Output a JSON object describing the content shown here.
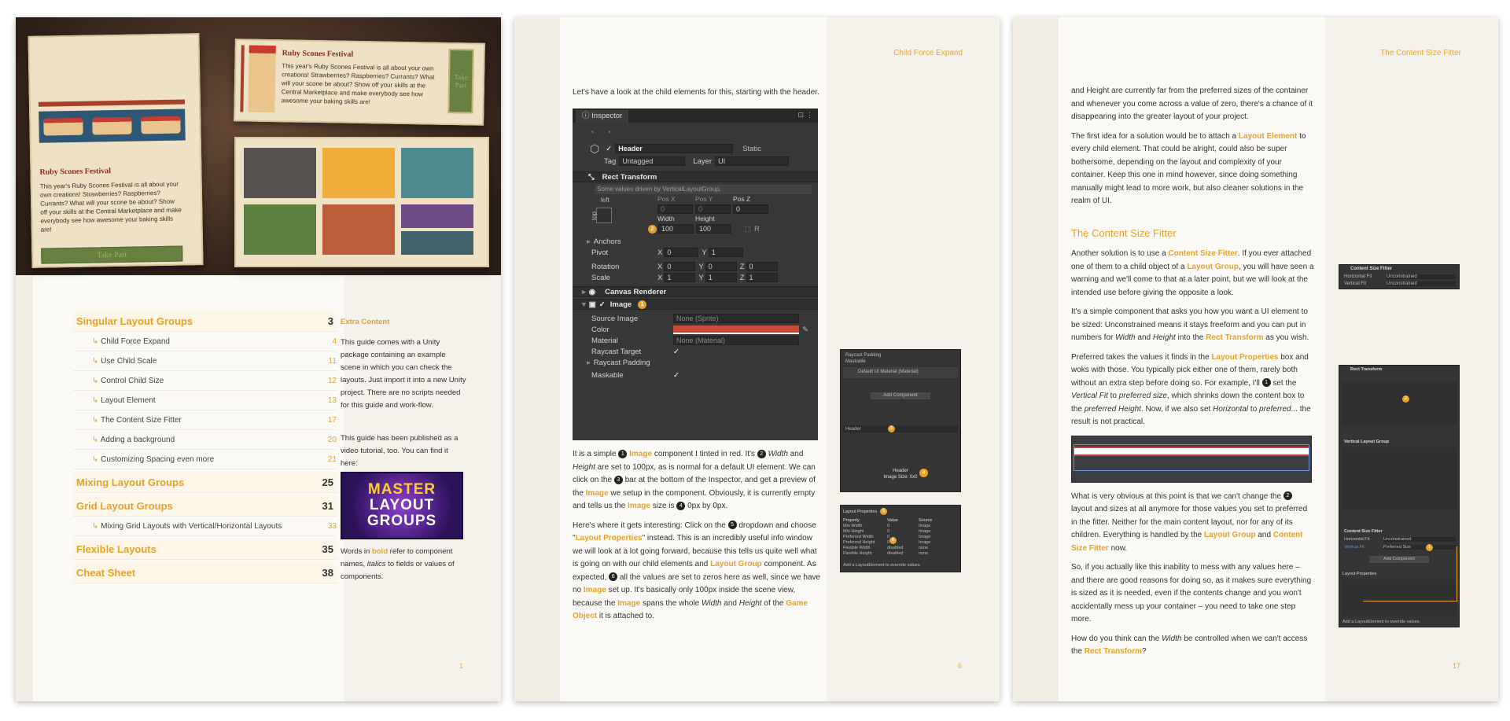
{
  "page1": {
    "cover": {
      "card_title": "Ruby Scones Festival",
      "card_text": "This year's Ruby Scones Festival is all about your own creations! Strawberries? Raspberries? Currants? What will your scone be about? Show off your skills at the Central Marketplace and make everybody see how awesome your baking skills are!",
      "card_button": "Take Part",
      "popup_title": "Ruby Scones Festival",
      "popup_text": "This year's Ruby Scones Festival is all about your own creations! Strawberries? Raspberries? Currants? What will your scone be about? Show off your skills at the Central Marketplace and make everybody see how awesome your baking skills are!",
      "popup_button": "Take Part",
      "swatches": [
        "#57524f",
        "#f2ae3a",
        "#4f8c92",
        "#5d7f3d",
        "#bc5e3c",
        "#6f4b86",
        "#41626d"
      ]
    },
    "toc": [
      {
        "title": "Singular Layout Groups",
        "page": "3",
        "level": "main"
      },
      {
        "title": "Child Force Expand",
        "page": "4",
        "level": "sub"
      },
      {
        "title": "Use Child Scale",
        "page": "11",
        "level": "sub"
      },
      {
        "title": "Control Child Size",
        "page": "12",
        "level": "sub"
      },
      {
        "title": "Layout Element",
        "page": "13",
        "level": "sub"
      },
      {
        "title": "The Content Size Fitter",
        "page": "17",
        "level": "sub"
      },
      {
        "title": "Adding a background",
        "page": "20",
        "level": "sub"
      },
      {
        "title": "Customizing Spacing even more",
        "page": "21",
        "level": "sub"
      },
      {
        "title": "Mixing Layout Groups",
        "page": "25",
        "level": "main"
      },
      {
        "title": "Grid Layout Groups",
        "page": "31",
        "level": "main"
      },
      {
        "title": "Mixing Grid Layouts with Vertical/Horizontal Layouts",
        "page": "33",
        "level": "sub"
      },
      {
        "title": "Flexible Layouts",
        "page": "35",
        "level": "main"
      },
      {
        "title": "Cheat Sheet",
        "page": "38",
        "level": "main"
      }
    ],
    "extra_title": "Extra Content",
    "extra_p1": "This guide comes with a Unity package containing an example scene in which you can check the layouts. Just import it into a new Unity project. There are no scripts needed for this guide and work-flow.",
    "extra_p2": "This guide has been published as a video tutorial, too. You can find it here:",
    "video_line1": "MASTER",
    "video_line2": "LAYOUT",
    "video_line3": "GROUPS",
    "words_a": "Words in ",
    "words_bold": "bold",
    "words_b": " refer to component names, ",
    "words_italic": "italics",
    "words_c": " to fields or values of components.",
    "folio": "1"
  },
  "page2": {
    "header": "Child Force Expand",
    "intro": "Let's have a look at the child elements for this, starting with the header.",
    "inspector": {
      "tab": "Inspector",
      "name": "Header",
      "static": "Static",
      "tag_label": "Tag",
      "tag_value": "Untagged",
      "layer_label": "Layer",
      "layer_value": "UI",
      "rect_transform": "Rect Transform",
      "driven_note": "Some values driven by VerticalLayoutGroup.",
      "anchor_label": "left",
      "anchor_side": "top",
      "posx": "Pos X",
      "posy": "Pos Y",
      "posz": "Pos Z",
      "posx_v": "0",
      "posy_v": "0",
      "posz_v": "0",
      "width_label": "Width",
      "height_label": "Height",
      "width_v": "100",
      "height_v": "100",
      "anchors": "Anchors",
      "pivot": "Pivot",
      "pivot_x": "0",
      "pivot_y": "1",
      "rotation": "Rotation",
      "rot_x": "0",
      "rot_y": "0",
      "rot_z": "0",
      "scale": "Scale",
      "scale_x": "1",
      "scale_y": "1",
      "scale_z": "1",
      "canvas_renderer": "Canvas Renderer",
      "image": "Image",
      "source_image": "Source Image",
      "source_image_v": "None (Sprite)",
      "color": "Color",
      "color_v": "#c94b3c",
      "material": "Material",
      "material_v": "None (Material)",
      "raycast_target": "Raycast Target",
      "raycast_padding": "Raycast Padding",
      "maskable": "Maskable"
    },
    "para1": {
      "a": "It is a simple ",
      "n1": "1",
      "b": " ",
      "image1": "Image",
      "c": " component I tinted in red. It's ",
      "n2": "2",
      "d": " ",
      "width": "Width",
      "e": " and ",
      "height": "Height",
      "f": " are set to 100px, as is normal for a default UI element. We can click on the ",
      "n3": "3",
      "g": " bar at the bottom of the Inspector, and get a preview of the ",
      "image2": "Image",
      "h": " we setup in the component. Obviously, it is currently empty and tells us the ",
      "image3": "Image",
      "i": " size is ",
      "n4": "4",
      "j": " 0px by 0px."
    },
    "para2": {
      "a": "Here's where it gets interesting: Click on the ",
      "n5": "5",
      "b": " dropdown and choose \"",
      "lp": "Layout Properties",
      "c": "\" instead. This is an incredibly useful info window we will look at a lot going forward, because this tells us quite well what is going on with our child elements and ",
      "lg": "Layout Group",
      "d": " component. As expected, ",
      "n6": "6",
      "e": " all the values are set to zeros here as well, since we have no ",
      "img": "Image",
      "f": " set up. It's basically only 100px inside the scene view, because the ",
      "img2": "Image",
      "g": " spans the whole ",
      "w": "Width",
      "h": " and ",
      "ht": "Height",
      "i": " of the ",
      "go": "Game Object",
      "j": " it is attached to."
    },
    "thumb1": {
      "title": "Raycast Padding",
      "row1": "Maskable",
      "row2": "Default UI Material (Material)",
      "add": "Add Component",
      "bar": "Header",
      "n3": "3",
      "foot1": "Header",
      "foot2": "Image Size: 0x0",
      "n4": "4"
    },
    "thumb2": {
      "title": "Layout Properties",
      "n5": "5",
      "cols": [
        "Property",
        "Value",
        "Source"
      ],
      "rows": [
        [
          "Min Width",
          "0",
          "Image"
        ],
        [
          "Min Height",
          "0",
          "Image"
        ],
        [
          "Preferred Width",
          "0",
          "Image"
        ],
        [
          "Preferred Height",
          "0",
          "Image"
        ],
        [
          "Flexible Width",
          "disabled",
          "none"
        ],
        [
          "Flexible Height",
          "disabled",
          "none"
        ]
      ],
      "n6": "6",
      "foot": "Add a LayoutElement to override values."
    },
    "folio": "6"
  },
  "page3": {
    "header": "The Content Size Fitter",
    "p1": "and Height are currently far from the preferred sizes of the container and whenever you come across a value of zero, there's a chance of it disappearing into the greater layout of your project.",
    "p2": {
      "a": "The first idea for a solution would be to attach a ",
      "le": "Layout Element",
      "b": " to every child element. That could be alright, could also be super bothersome, depending on the layout and complexity of your container. Keep this one in mind however, since doing something manually might lead to more work, but also cleaner solutions in the realm of UI."
    },
    "heading": "The Content Size Fitter",
    "p3": {
      "a": "Another solution is to use a ",
      "csf": "Content Size Fitter",
      "b": ". If you ever attached one of them to a child object of a ",
      "lg": "Layout Group",
      "c": ", you will have seen a warning and we'll come to that at a later point, but we will look at the intended use before giving the opposite a look."
    },
    "p4": {
      "a": "It's a simple component that asks you how you want a UI element to be sized: Unconstrained means it stays freeform and you can put in numbers for ",
      "w": "Width",
      "b": " and ",
      "h": "Height",
      "c": " into the ",
      "rt": "Rect Transform",
      "d": " as you wish."
    },
    "p5": {
      "a": "Preferred takes the values it finds in the ",
      "lp": "Layout Properties",
      "b": " box and woks with those. You typically pick either one of them, rarely both without an extra step before doing so. For example, I'll ",
      "n1": "1",
      "c": " set the ",
      "vf": "Vertical Fit",
      "d": " to ",
      "ps": "preferred size",
      "e": ", which shrinks down the content box to the ",
      "ph": "preferred Height",
      "f": ". Now, if we also set ",
      "hz": "Horizontal",
      "g": " to ",
      "pr": "preferred",
      "h": "... the result is not practical."
    },
    "p6": {
      "a": "What is very obvious at this point is that we can't change the ",
      "n2": "2",
      "b": " layout and sizes at all anymore for those values you set to preferred in the fitter. Neither for the main content layout, nor for any of its children. Everything is handled by the ",
      "lg": "Layout Group",
      "c": " and ",
      "csf": "Content Size Fitter",
      "d": " now."
    },
    "p7": "So, if you actually like this inability to mess with any values here – and there are good reasons for doing so, as it makes sure everything is sized as it is needed, even if the contents change and you won't accidentally mess up your container – you need to take one step more.",
    "p8": {
      "a": "How do you think can the ",
      "w": "Width",
      "b": " be controlled when we can't access the ",
      "rt": "Rect Transform",
      "c": "?"
    },
    "side1": {
      "title": "Content Size Fitter",
      "r1": "Horizontal Fit",
      "r1v": "Unconstrained",
      "r2": "Vertical Fit",
      "r2v": "Unconstrained"
    },
    "side2": {
      "title": "Rect Transform",
      "vlg": "Vertical Layout Group",
      "csf": "Content Size Fitter",
      "hf": "Horizontal Fit",
      "hfv": "Unconstrained",
      "vf": "Vertical Fit",
      "vfv": "Preferred Size",
      "add": "Add Component",
      "lp": "Layout Properties",
      "foot": "Add a LayoutElement to override values.",
      "n1": "1",
      "n2": "2"
    },
    "folio": "17"
  }
}
